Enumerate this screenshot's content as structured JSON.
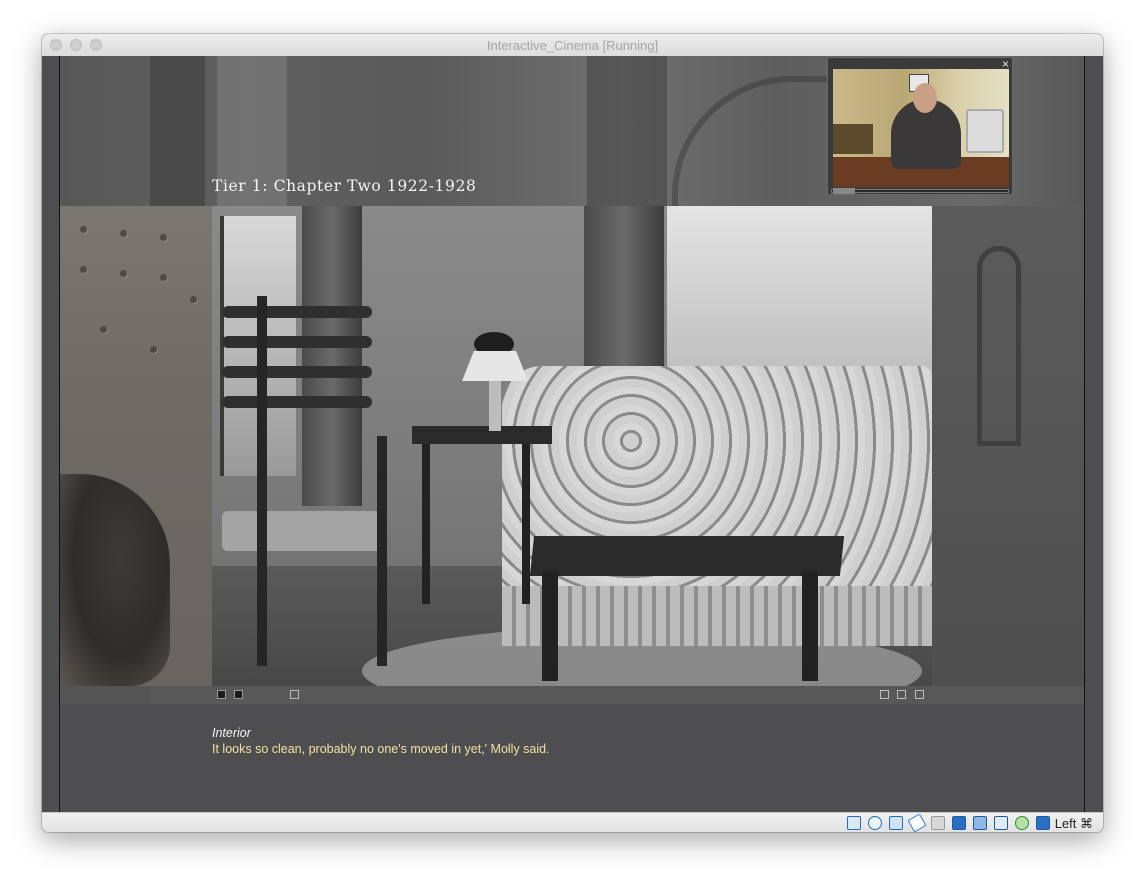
{
  "window": {
    "title": "Interactive_Cinema [Running]"
  },
  "player": {
    "chapter_title": "Tier 1: Chapter Two 1922-1928",
    "caption": {
      "label": "Interior",
      "text": "It looks so clean, probably no one's moved in yet,' Molly said."
    },
    "pip": {
      "close_glyph": "×"
    }
  },
  "statusbar": {
    "host_key": "Left ⌘",
    "icons": [
      "hard-disk-icon",
      "optical-drive-icon",
      "network-icon",
      "usb-icon",
      "shared-folders-icon",
      "display-icon",
      "video-capture-icon",
      "cpu-icon",
      "recording-icon",
      "mouse-integration-icon",
      "keyboard-icon"
    ]
  }
}
